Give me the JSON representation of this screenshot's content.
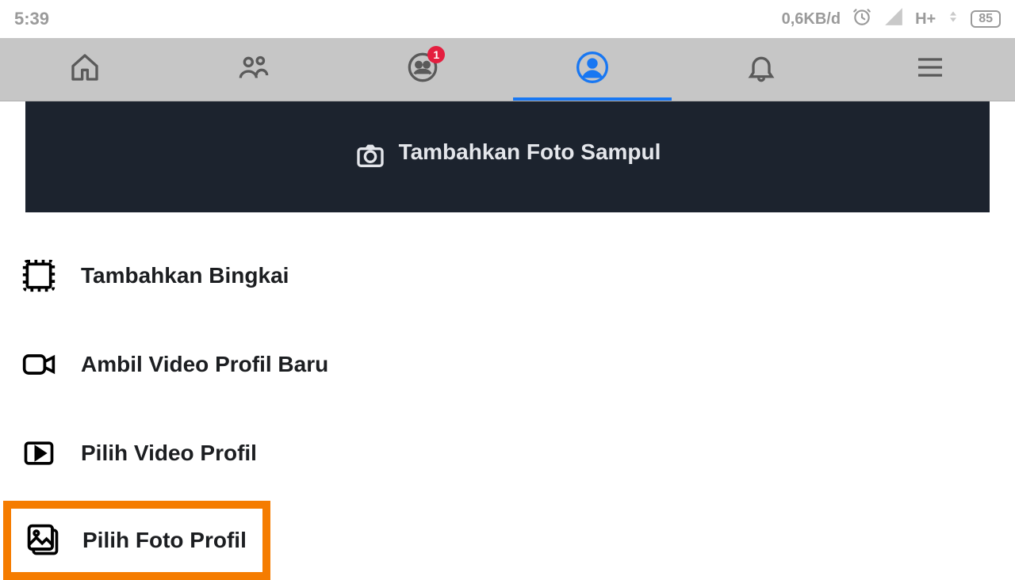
{
  "status": {
    "time": "5:39",
    "data_rate": "0,6KB/d",
    "network_label": "H+",
    "battery_pct": "85"
  },
  "tabs": {
    "groups_badge": "1"
  },
  "cover": {
    "add_cover_label": "Tambahkan Foto Sampul"
  },
  "menu": {
    "add_frame": "Tambahkan Bingkai",
    "take_video": "Ambil Video Profil Baru",
    "select_video": "Pilih Video Profil",
    "select_photo": "Pilih Foto Profil"
  }
}
